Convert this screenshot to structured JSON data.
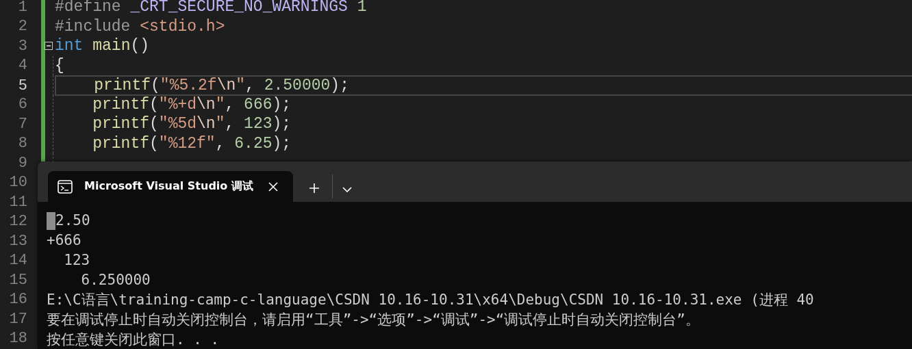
{
  "editor": {
    "lines": [
      {
        "number": "1",
        "current": false,
        "fold_marker": false,
        "tokens": [
          {
            "kind": "preproc",
            "text": "#define "
          },
          {
            "kind": "macro",
            "text": "_CRT_SECURE_NO_WARNINGS"
          },
          {
            "kind": "number",
            "text": " 1"
          }
        ]
      },
      {
        "number": "2",
        "current": false,
        "fold_marker": false,
        "tokens": [
          {
            "kind": "preproc",
            "text": "#include "
          },
          {
            "kind": "string",
            "text": "<stdio.h>"
          }
        ]
      },
      {
        "number": "3",
        "current": false,
        "fold_marker": true,
        "tokens": [
          {
            "kind": "keyword",
            "text": "int"
          },
          {
            "kind": "function",
            "text": " main"
          },
          {
            "kind": "plain",
            "text": "()"
          }
        ]
      },
      {
        "number": "4",
        "current": false,
        "fold_marker": false,
        "tokens": [
          {
            "kind": "plain",
            "text": "{"
          }
        ]
      },
      {
        "number": "5",
        "current": true,
        "fold_marker": false,
        "tokens": [
          {
            "kind": "function",
            "text": "    printf"
          },
          {
            "kind": "plain",
            "text": "("
          },
          {
            "kind": "string",
            "text": "\"%5.2f"
          },
          {
            "kind": "escape",
            "text": "\\n"
          },
          {
            "kind": "string",
            "text": "\""
          },
          {
            "kind": "plain",
            "text": ", "
          },
          {
            "kind": "number",
            "text": "2.50000"
          },
          {
            "kind": "plain",
            "text": ");"
          }
        ]
      },
      {
        "number": "6",
        "current": false,
        "fold_marker": false,
        "tokens": [
          {
            "kind": "function",
            "text": "    printf"
          },
          {
            "kind": "plain",
            "text": "("
          },
          {
            "kind": "string",
            "text": "\"%+d"
          },
          {
            "kind": "escape",
            "text": "\\n"
          },
          {
            "kind": "string",
            "text": "\""
          },
          {
            "kind": "plain",
            "text": ", "
          },
          {
            "kind": "number",
            "text": "666"
          },
          {
            "kind": "plain",
            "text": ");"
          }
        ]
      },
      {
        "number": "7",
        "current": false,
        "fold_marker": false,
        "tokens": [
          {
            "kind": "function",
            "text": "    printf"
          },
          {
            "kind": "plain",
            "text": "("
          },
          {
            "kind": "string",
            "text": "\"%5d"
          },
          {
            "kind": "escape",
            "text": "\\n"
          },
          {
            "kind": "string",
            "text": "\""
          },
          {
            "kind": "plain",
            "text": ", "
          },
          {
            "kind": "number",
            "text": "123"
          },
          {
            "kind": "plain",
            "text": ");"
          }
        ]
      },
      {
        "number": "8",
        "current": false,
        "fold_marker": false,
        "tokens": [
          {
            "kind": "function",
            "text": "    printf"
          },
          {
            "kind": "plain",
            "text": "("
          },
          {
            "kind": "string",
            "text": "\"%12f\""
          },
          {
            "kind": "plain",
            "text": ", "
          },
          {
            "kind": "number",
            "text": "6.25"
          },
          {
            "kind": "plain",
            "text": ");"
          }
        ]
      },
      {
        "number": "9",
        "current": false,
        "fold_marker": false
      },
      {
        "number": "10",
        "current": false,
        "fold_marker": false
      },
      {
        "number": "11",
        "current": false,
        "fold_marker": false
      },
      {
        "number": "12",
        "current": false,
        "fold_marker": false
      },
      {
        "number": "13",
        "current": false,
        "fold_marker": false
      },
      {
        "number": "14",
        "current": false,
        "fold_marker": false
      },
      {
        "number": "15",
        "current": false,
        "fold_marker": false
      },
      {
        "number": "16",
        "current": false,
        "fold_marker": false
      },
      {
        "number": "17",
        "current": false,
        "fold_marker": false
      },
      {
        "number": "18",
        "current": false,
        "fold_marker": false
      }
    ]
  },
  "terminal": {
    "tab_title": "Microsoft Visual Studio 调试",
    "cursor_visible": true,
    "output": [
      {
        "text": "2.50"
      },
      {
        "text": "+666"
      },
      {
        "text": "  123"
      },
      {
        "text": "    6.250000"
      },
      {
        "text": "E:\\C语言\\training-camp-c-language\\CSDN 10.16-10.31\\x64\\Debug\\CSDN 10.16-10.31.exe (进程 40"
      },
      {
        "text": "要在调试停止时自动关闭控制台，请启用“工具”->“选项”->“调试”->“调试停止时自动关闭控制台”。"
      },
      {
        "text": "按任意键关闭此窗口. . ."
      }
    ]
  }
}
